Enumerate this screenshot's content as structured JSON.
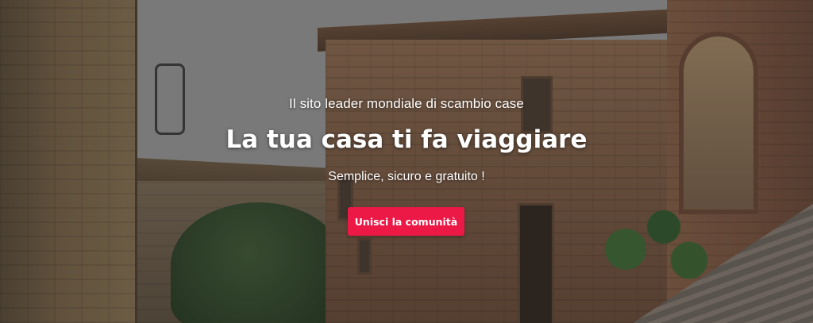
{
  "hero": {
    "subtitle": "Il sito leader mondiale di scambio case",
    "headline": "La tua casa ti fa viaggiare",
    "tagline": "Semplice, sicuro e gratuito !",
    "cta_label": "Unisci la comunità"
  },
  "colors": {
    "accent": "#ec1846",
    "text": "#ffffff"
  }
}
